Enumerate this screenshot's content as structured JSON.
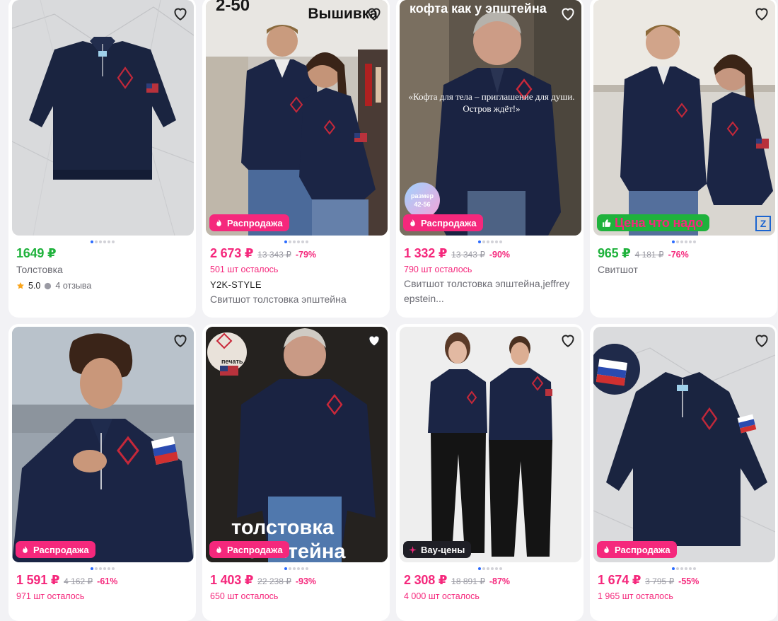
{
  "products": [
    {
      "price": "1649 ₽",
      "old_price": "",
      "discount": "",
      "stock": "",
      "brand": "",
      "title": "Толстовка",
      "rating": "5.0",
      "reviews": "4 отзыва",
      "badge": "",
      "overlay": {}
    },
    {
      "price": "2 673 ₽",
      "old_price": "13 343 ₽",
      "discount": "-79%",
      "stock": "501 шт осталось",
      "brand": "Y2K-STYLE",
      "title": "Свитшот толстовка эпштейна",
      "badge": "Распродажа",
      "overlay": {
        "top_left": "2-50",
        "top_right": "Вышивка"
      }
    },
    {
      "price": "1 332 ₽",
      "old_price": "13 343 ₽",
      "discount": "-90%",
      "stock": "790 шт осталось",
      "brand": "",
      "title": "Свитшот толстовка эпштейна,jeffrey epstein...",
      "badge": "Распродажа",
      "overlay": {
        "headline": "кофта как у эпштейна",
        "quote": "«Кофта для тела – приглашение для души. Остров ждёт!»",
        "size_label": "размер",
        "size_value": "42-56"
      }
    },
    {
      "price": "965 ₽",
      "old_price": "4 181 ₽",
      "discount": "-76%",
      "stock": "",
      "brand": "",
      "title": "Свитшот",
      "badge": "Цена что надо",
      "overlay": {}
    },
    {
      "price": "1 591 ₽",
      "old_price": "4 162 ₽",
      "discount": "-61%",
      "stock": "971 шт осталось",
      "badge": "Распродажа",
      "overlay": {}
    },
    {
      "price": "1 403 ₽",
      "old_price": "22 238 ₽",
      "discount": "-93%",
      "stock": "650 шт осталось",
      "badge": "Распродажа",
      "overlay": {
        "print_label": "печать",
        "bottom_line1": "толстовка",
        "bottom_line2": "эпштейна"
      }
    },
    {
      "price": "2 308 ₽",
      "old_price": "18 891 ₽",
      "discount": "-87%",
      "stock": "4 000 шт осталось",
      "badge": "Вау-цены",
      "overlay": {}
    },
    {
      "price": "1 674 ₽",
      "old_price": "3 795 ₽",
      "discount": "-55%",
      "stock": "1 965 шт осталось",
      "badge": "Распродажа",
      "overlay": {}
    }
  ],
  "colors": {
    "accent_pink": "#f5287c",
    "accent_green": "#1fb23c",
    "navy_garment": "#1c2645",
    "dot_active": "#2b6bff"
  }
}
